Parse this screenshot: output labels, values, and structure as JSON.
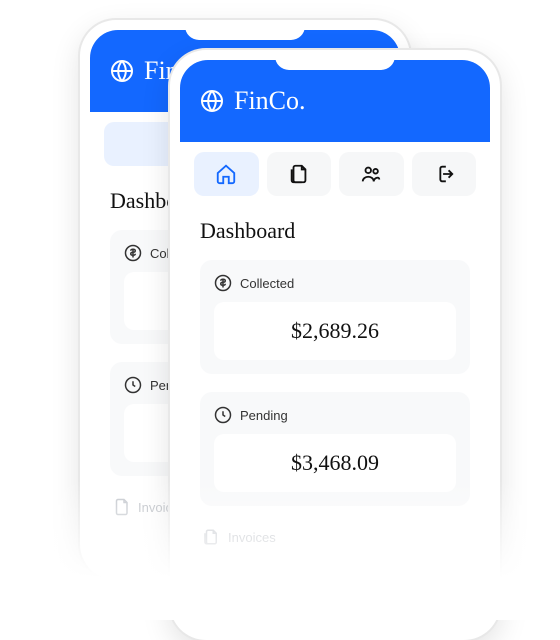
{
  "brand": "FinCo.",
  "nav": {
    "home": "home",
    "docs": "documents",
    "people": "people",
    "exit": "logout"
  },
  "page_title": "Dashboard",
  "cards": {
    "collected": {
      "label": "Collected",
      "value": "$2,689.26"
    },
    "pending": {
      "label": "Pending",
      "value": "$3,468.09"
    }
  },
  "sections": {
    "invoices": "Invoices"
  },
  "back_phone": {
    "page_title": "Dashboard",
    "collected_label": "Collected",
    "pending_label": "Pending",
    "invoices": "Invoices"
  }
}
